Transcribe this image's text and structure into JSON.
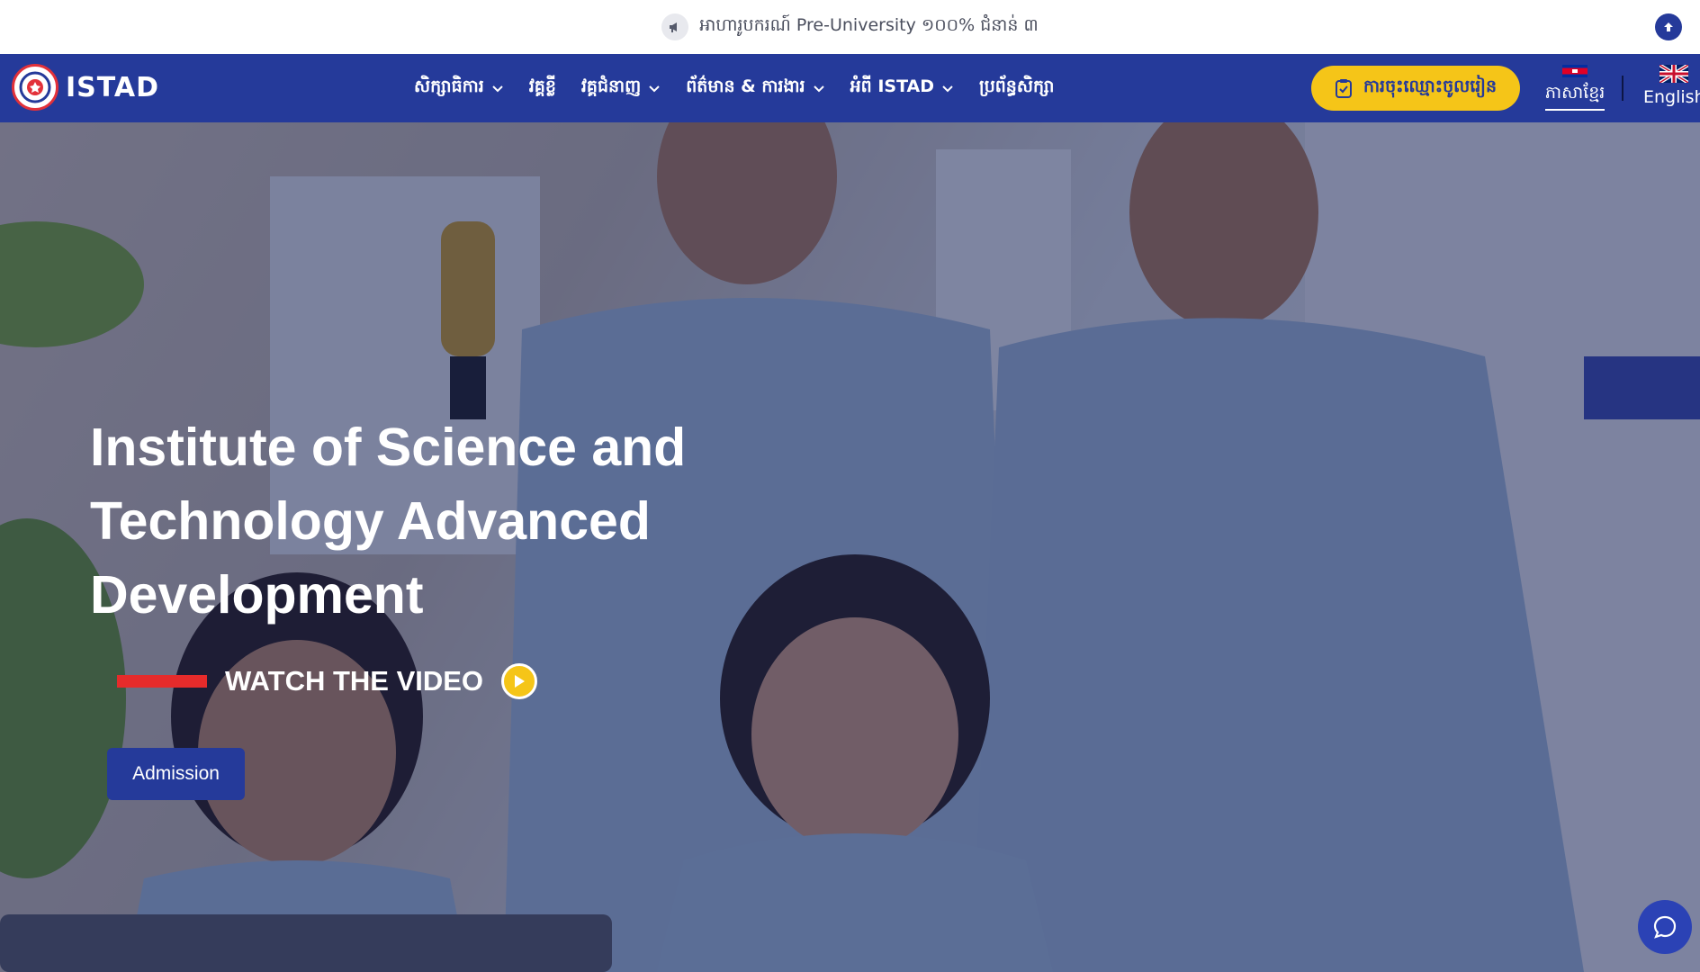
{
  "announcement": {
    "text": "អាហារូបករណ៍ Pre-University ១០០% ជំនាន់ ៣"
  },
  "brand": {
    "name": "ISTAD"
  },
  "nav": {
    "items": [
      {
        "label": "សិក្សាធិការ",
        "has_dropdown": true
      },
      {
        "label": "វគ្គខ្លី",
        "has_dropdown": false
      },
      {
        "label": "វគ្គជំនាញ",
        "has_dropdown": true
      },
      {
        "label": "ព័ត៌មាន & ការងារ",
        "has_dropdown": true
      },
      {
        "label": "អំពី ISTAD",
        "has_dropdown": true
      },
      {
        "label": "ប្រព័ន្ធសិក្សា",
        "has_dropdown": false
      }
    ],
    "enroll_label": "ការចុះឈ្មោះចូលរៀន",
    "languages": [
      {
        "label": "ភាសាខ្មែរ",
        "active": true
      },
      {
        "label": "English",
        "active": false
      }
    ]
  },
  "hero": {
    "title_lines": [
      "Institute of Science and",
      "Technology Advanced",
      "Development"
    ],
    "watch_label": "WATCH THE VIDEO",
    "admission_label": "Admission"
  },
  "colors": {
    "primary": "#253a9a",
    "accent": "#f5c518",
    "red": "#e62b2b"
  },
  "icons": {
    "announcement": "megaphone-icon",
    "scroll_top": "arrow-up-icon",
    "enroll": "clipboard-check-icon",
    "play": "play-icon",
    "chat": "chat-bubble-icon"
  }
}
